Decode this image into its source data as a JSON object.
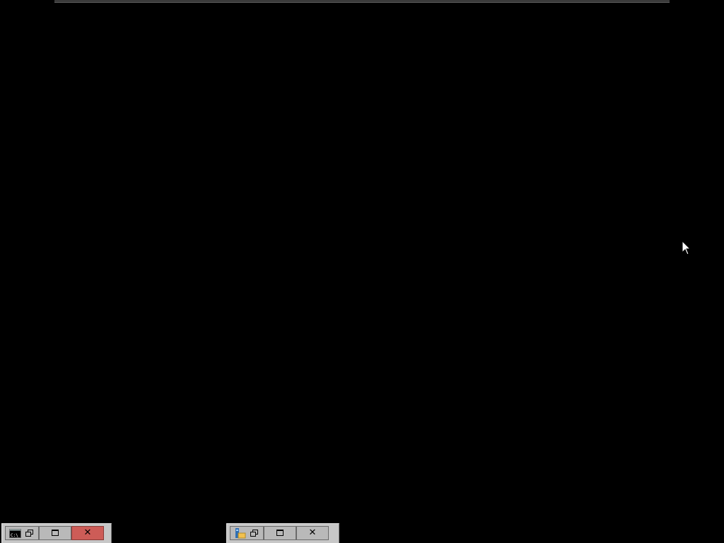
{
  "desktop": {
    "background": "#000000"
  },
  "minimized_windows": [
    {
      "app": "command-prompt",
      "icon": "command-prompt-icon",
      "icon_text": "C:\\",
      "close_highlighted": true,
      "close_color": "#cd5c57"
    },
    {
      "app": "file-explorer",
      "icon": "folder-icon",
      "close_highlighted": false
    }
  ],
  "cursor": {
    "icon": "mouse-pointer-icon"
  }
}
